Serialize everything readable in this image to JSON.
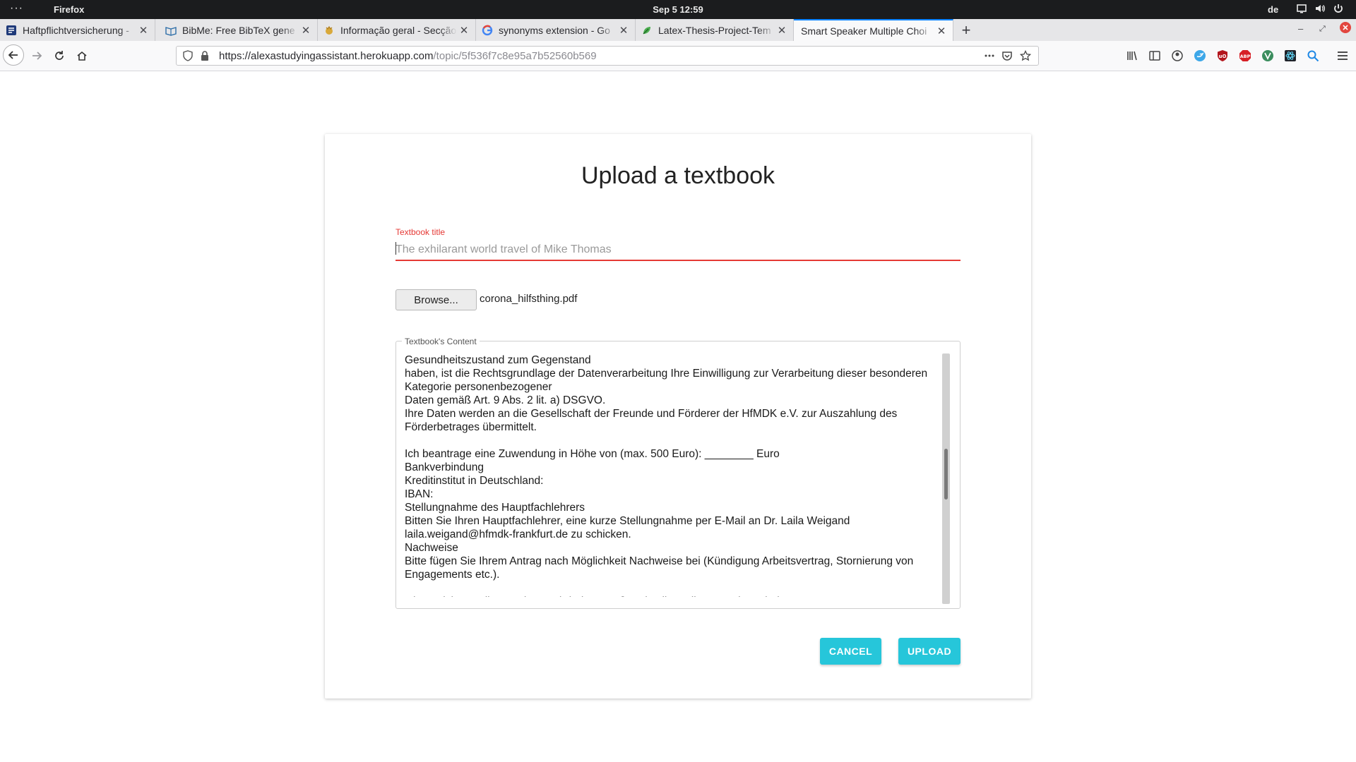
{
  "system_bar": {
    "activities": "···",
    "app_name": "Firefox",
    "clock": "Sep 5  12:59",
    "language": "de"
  },
  "tabs": [
    {
      "label": "Haftpflichtversicherung -",
      "icon": "document-icon",
      "active": false
    },
    {
      "label": "BibMe: Free BibTeX gene",
      "icon": "book-icon",
      "active": false
    },
    {
      "label": "Informação geral - Secção",
      "icon": "crest-icon",
      "active": false
    },
    {
      "label": "synonyms extension - Go",
      "icon": "google-icon",
      "active": false
    },
    {
      "label": "Latex-Thesis-Project-Tem",
      "icon": "leaf-icon",
      "active": false
    },
    {
      "label": "Smart Speaker Multiple Choi",
      "icon": "",
      "active": true
    }
  ],
  "address_bar": {
    "host": "https://alexastudyingassistant.herokuapp.com",
    "path": "/topic/5f536f7c8e95a7b52560b569"
  },
  "page": {
    "heading": "Upload a textbook",
    "title_label": "Textbook title",
    "title_placeholder": "The exhilarant world travel of Mike Thomas",
    "browse_label": "Browse...",
    "file_name": "corona_hilfsthing.pdf",
    "content_label": "Textbook's Content",
    "content_text": "Gesundheitszustand zum Gegenstand\nhaben, ist die Rechtsgrundlage der Datenverarbeitung Ihre Einwilligung zur Verarbeitung dieser besonderen Kategorie personenbezogener\nDaten gemäß Art. 9 Abs. 2 lit. a) DSGVO.\nIhre Daten werden an die Gesellschaft der Freunde und Förderer der HfMDK e.V. zur Auszahlung des Förderbetrages übermittelt.\n\nIch beantrage eine Zuwendung in Höhe von (max. 500 Euro): ________ Euro\nBankverbindung\nKreditinstitut in Deutschland:\nIBAN:\nStellungnahme des Hauptfachlehrers\nBitten Sie Ihren Hauptfachlehrer, eine kurze Stellungnahme per E-Mail an Dr. Laila Weigand\nlaila.weigand@hfmdk-frankfurt.de zu schicken.\nNachweise\nBitte fügen Sie Ihrem Antrag nach Möglichkeit Nachweise bei (Kündigung Arbeitsvertrag, Stornierung von Engagements etc.).\n\nIch versichere, alle Angaben wahrheitsgemäß und vollständig gemacht zu haben.",
    "cancel_label": "CANCEL",
    "upload_label": "UPLOAD"
  },
  "colors": {
    "accent": "#26c6da",
    "error": "#e53935",
    "tab_highlight": "#0a84ff"
  }
}
